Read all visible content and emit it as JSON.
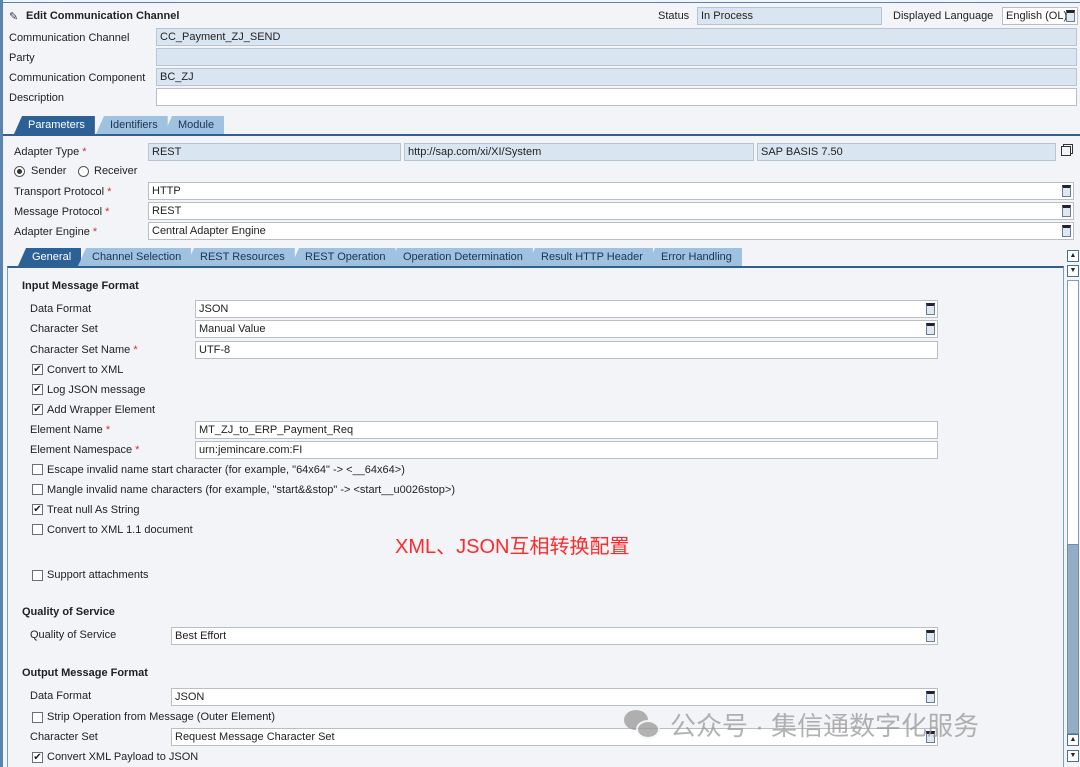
{
  "header": {
    "title": "Edit Communication Channel",
    "status_label": "Status",
    "status_value": "In Process",
    "language_label": "Displayed Language",
    "language_value": "English (OL)"
  },
  "channel": {
    "cc_label": "Communication Channel",
    "cc_value": "CC_Payment_ZJ_SEND",
    "party_label": "Party",
    "party_value": "",
    "component_label": "Communication Component",
    "component_value": "BC_ZJ",
    "description_label": "Description",
    "description_value": ""
  },
  "tabs": [
    "Parameters",
    "Identifiers",
    "Module"
  ],
  "adapter": {
    "type_label": "Adapter Type",
    "type_value": "REST",
    "namespace": "http://sap.com/xi/XI/System",
    "swcv": "SAP BASIS 7.50",
    "sender": "Sender",
    "receiver": "Receiver",
    "transport_label": "Transport Protocol",
    "transport_value": "HTTP",
    "message_label": "Message Protocol",
    "message_value": "REST",
    "engine_label": "Adapter Engine",
    "engine_value": "Central Adapter Engine",
    "required": "*"
  },
  "subtabs": [
    "General",
    "Channel Selection",
    "REST Resources",
    "REST Operation",
    "Operation Determination",
    "Result HTTP Header",
    "Error Handling"
  ],
  "input": {
    "heading": "Input Message Format",
    "data_format_label": "Data Format",
    "data_format": "JSON",
    "charset_label": "Character Set",
    "charset": "Manual Value",
    "charset_name_label": "Character Set Name",
    "charset_name": "UTF-8",
    "convert_xml": "Convert to XML",
    "log_json": "Log JSON message",
    "add_wrapper": "Add Wrapper Element",
    "element_name_label": "Element Name",
    "element_name": "MT_ZJ_to_ERP_Payment_Req",
    "element_ns_label": "Element Namespace",
    "element_ns": "urn:jemincare.com:FI",
    "escape": "Escape invalid name start character (for example, \"64x64\" -> <__64x64>)",
    "mangle": "Mangle invalid name characters (for example, \"start&&stop\" -> <start__u0026stop>)",
    "treat_null": "Treat null As String",
    "xml11": "Convert to XML 1.1 document",
    "support_att": "Support attachments"
  },
  "annotation": "XML、JSON互相转换配置",
  "qos": {
    "heading": "Quality of Service",
    "label": "Quality of Service",
    "value": "Best Effort"
  },
  "output": {
    "heading": "Output Message Format",
    "data_format_label": "Data Format",
    "data_format": "JSON",
    "strip": "Strip Operation from Message (Outer Element)",
    "charset_label": "Character Set",
    "charset": "Request Message Character Set",
    "convert_json": "Convert XML Payload to JSON"
  },
  "watermark": "公众号 · 集信通数字化服务",
  "colors": {
    "accent": "#2d6196",
    "annotation": "#ff2a2a"
  }
}
